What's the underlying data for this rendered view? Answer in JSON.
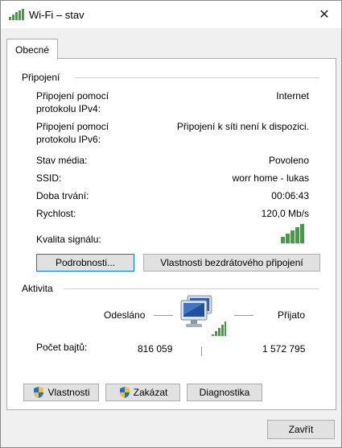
{
  "window": {
    "title": "Wi-Fi – stav",
    "close_glyph": "✕"
  },
  "tabs": [
    {
      "label": "Obecné"
    }
  ],
  "connection": {
    "section_label": "Připojení",
    "ipv4_label_line1": "Připojení pomocí",
    "ipv4_label_line2": "protokolu IPv4:",
    "ipv4_value": "Internet",
    "ipv6_label_line1": "Připojení pomocí",
    "ipv6_label_line2": "protokolu IPv6:",
    "ipv6_value": "Připojení k síti není k dispozici.",
    "media_label": "Stav média:",
    "media_value": "Povoleno",
    "ssid_label": "SSID:",
    "ssid_value": "worr home - lukas",
    "duration_label": "Doba trvání:",
    "duration_value": "00:06:43",
    "speed_label": "Rychlost:",
    "speed_value": "120,0 Mb/s",
    "signal_label": "Kvalita signálu:",
    "signal_bars": 5,
    "details_button": "Podrobnosti...",
    "wireless_props_button": "Vlastnosti bezdrátového připojení"
  },
  "activity": {
    "section_label": "Aktivita",
    "sent_label": "Odesláno",
    "received_label": "Přijato",
    "bytes_label": "Počet bajtů:",
    "bytes_sent": "816 059",
    "bytes_received": "1 572 795"
  },
  "actions": {
    "properties_button": "Vlastnosti",
    "disable_button": "Zakázat",
    "diagnostics_button": "Diagnostika"
  },
  "footer": {
    "close_button": "Zavřít"
  },
  "colors": {
    "signal_green": "#3aa43a",
    "focus_border": "#0078d7"
  }
}
